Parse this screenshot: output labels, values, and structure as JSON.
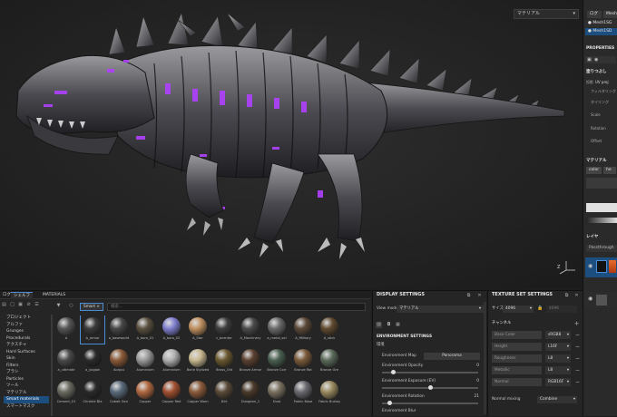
{
  "colors": {
    "accent": "#4a8cd6",
    "selection": "#1d4e80",
    "glow": "#b040ff"
  },
  "viewport": {
    "mode_dropdown": "マテリアル"
  },
  "right_dock": {
    "top_buttons": [
      "ログ",
      "Mesh1SD"
    ],
    "items": [
      "Mesh1SG",
      "Mesh1SD"
    ],
    "properties_title": "PROPERTIES",
    "fill_title": "塗りつぶし",
    "fill_rows": [
      "投影",
      "フィルタリング",
      "タイリング",
      "Scale",
      "Rotation",
      "Offset"
    ],
    "projection_value": "UV proj",
    "material_title": "マテリアル",
    "material_buttons": [
      "color",
      "he"
    ],
    "layers_title": "レイヤ",
    "blend_mode": "Passthrough"
  },
  "left_panel": {
    "tabs": [
      "ログ",
      "シェルフ",
      "MATERIALS"
    ],
    "categories": [
      "プロジェクト",
      "アルファ",
      "Grunges",
      "Procedurals",
      "テクスチャ",
      "Hard Surfaces",
      "Skin",
      "Filters",
      "ブラシ",
      "Particles",
      "ツール",
      "マテリアル",
      "Smart materials",
      "スマートマスク"
    ],
    "selected_category": "Smart materials",
    "filter_chip": "Smart",
    "search_placeholder": "検索...",
    "materials": [
      {
        "name": "A",
        "color": "#555"
      },
      {
        "name": "A_armor",
        "color": "#3a3a3a"
      },
      {
        "name": "a_baseworld",
        "color": "#474747"
      },
      {
        "name": "A_bora_01",
        "color": "#5a5040"
      },
      {
        "name": "A_bora_02",
        "color": "#8080d0"
      },
      {
        "name": "A_Star",
        "color": "#c09060"
      },
      {
        "name": "c_bcenter",
        "color": "#3d3d3d"
      },
      {
        "name": "A_Machinery",
        "color": "#4a4a4a"
      },
      {
        "name": "a_metal_sel",
        "color": "#6a6a6a"
      },
      {
        "name": "A_Military",
        "color": "#5a4838"
      },
      {
        "name": "A_stick",
        "color": "#604a30"
      },
      {
        "name": "a_ultimate",
        "color": "#4a4a4a"
      },
      {
        "name": "a_yogow",
        "color": "#2a2a2a"
      },
      {
        "name": "Acajou",
        "color": "#8a5a38"
      },
      {
        "name": "Aluminium",
        "color": "#9a9a9a"
      },
      {
        "name": "Aluminium",
        "color": "#b0b0b0"
      },
      {
        "name": "Bone Stylized",
        "color": "#c8b890"
      },
      {
        "name": "Brass_Old",
        "color": "#6a5830"
      },
      {
        "name": "Bronze Armor",
        "color": "#5a4030"
      },
      {
        "name": "Bronze Corr",
        "color": "#4a6050"
      },
      {
        "name": "Bronze Rot",
        "color": "#7a5a3a"
      },
      {
        "name": "Bronze Gre",
        "color": "#5a6a5a"
      },
      {
        "name": "Cement_01",
        "color": "#6a6a60"
      },
      {
        "name": "Chrome Bla",
        "color": "#2a2a2a"
      },
      {
        "name": "Cobalt Gen",
        "color": "#5a6a7a"
      },
      {
        "name": "Copper",
        "color": "#b06840"
      },
      {
        "name": "Copper Red",
        "color": "#a05030"
      },
      {
        "name": "Copper Worn",
        "color": "#8a5a3a"
      },
      {
        "name": "Dirt",
        "color": "#5a4a38"
      },
      {
        "name": "Dungeon_1",
        "color": "#4a3a2a"
      },
      {
        "name": "Dust",
        "color": "#7a7060"
      },
      {
        "name": "Fabric Base",
        "color": "#6a6a70"
      },
      {
        "name": "Fabric Burlap",
        "color": "#9a8a60"
      }
    ]
  },
  "display_settings": {
    "title": "DISPLAY SETTINGS",
    "view_mode_label": "View mode",
    "view_mode_value": "マテリアル",
    "env_section": "ENVIRONMENT SETTINGS",
    "env_sub": "環境",
    "env_map_label": "Environment Map",
    "env_map_value": "Panorama",
    "rows": [
      {
        "label": "Environment Opacity",
        "value": "0",
        "pos": 0.1
      },
      {
        "label": "Environment Exposure (EV)",
        "value": "0",
        "pos": 0.5
      },
      {
        "label": "Environment Rotation",
        "value": "21",
        "pos": 0.06
      }
    ],
    "last_row": "Environment Blur"
  },
  "texture_set": {
    "title": "TEXTURE SET SETTINGS",
    "size_label": "サイズ",
    "size_value": "4096",
    "size_right": "4096",
    "channels_title": "チャンネル",
    "channels": [
      {
        "name": "Base Color",
        "format": "sRGB8"
      },
      {
        "name": "Height",
        "format": "L16F"
      },
      {
        "name": "Roughness",
        "format": "L8"
      },
      {
        "name": "Metallic",
        "format": "L8"
      },
      {
        "name": "Normal",
        "format": "RGB16F"
      }
    ],
    "normal_mixing_label": "Normal mixing",
    "normal_mixing_value": "Combine"
  }
}
